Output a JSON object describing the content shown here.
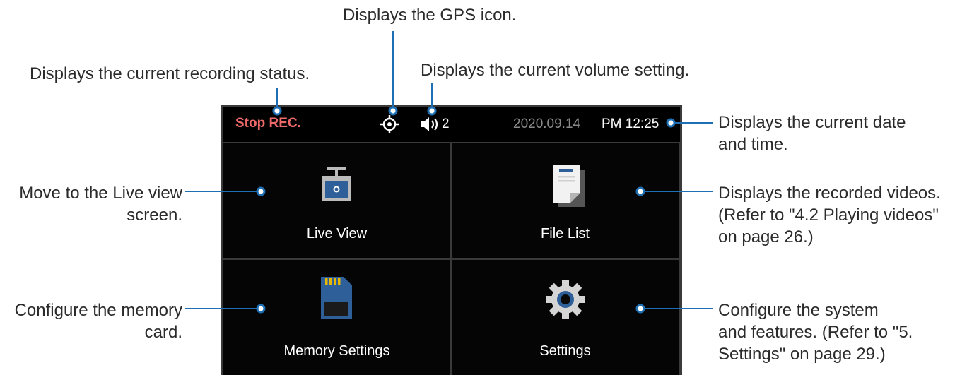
{
  "callouts": {
    "gps": "Displays the GPS icon.",
    "recording": "Displays the current recording status.",
    "volume": "Displays the current volume setting.",
    "datetime": [
      "Displays the current date",
      "and time."
    ],
    "liveview": [
      "Move to the Live view",
      "screen."
    ],
    "filelist": [
      "Displays the recorded videos.",
      "(Refer to \"4.2 Playing videos\"",
      "on page 26.)"
    ],
    "memory": [
      "Configure the memory",
      "card."
    ],
    "settings": [
      "Configure the system",
      "and features. (Refer to \"5.",
      "Settings\" on page 29.)"
    ]
  },
  "screen": {
    "status_bar": {
      "recording_status": "Stop REC.",
      "gps_icon": "gps-icon",
      "volume_icon": "speaker-icon",
      "volume_level": "2",
      "date": "2020.09.14",
      "time": "PM 12:25"
    },
    "tiles": [
      {
        "label": "Live View",
        "icon": "camera-icon"
      },
      {
        "label": "File List",
        "icon": "document-icon"
      },
      {
        "label": "Memory Settings",
        "icon": "sd-card-icon"
      },
      {
        "label": "Settings",
        "icon": "gear-icon"
      }
    ]
  },
  "colors": {
    "rec_status": "#ee6a6a",
    "leader_line": "#1f6fb4",
    "screen_bg": "#000000",
    "divider": "#3a3a3a"
  }
}
